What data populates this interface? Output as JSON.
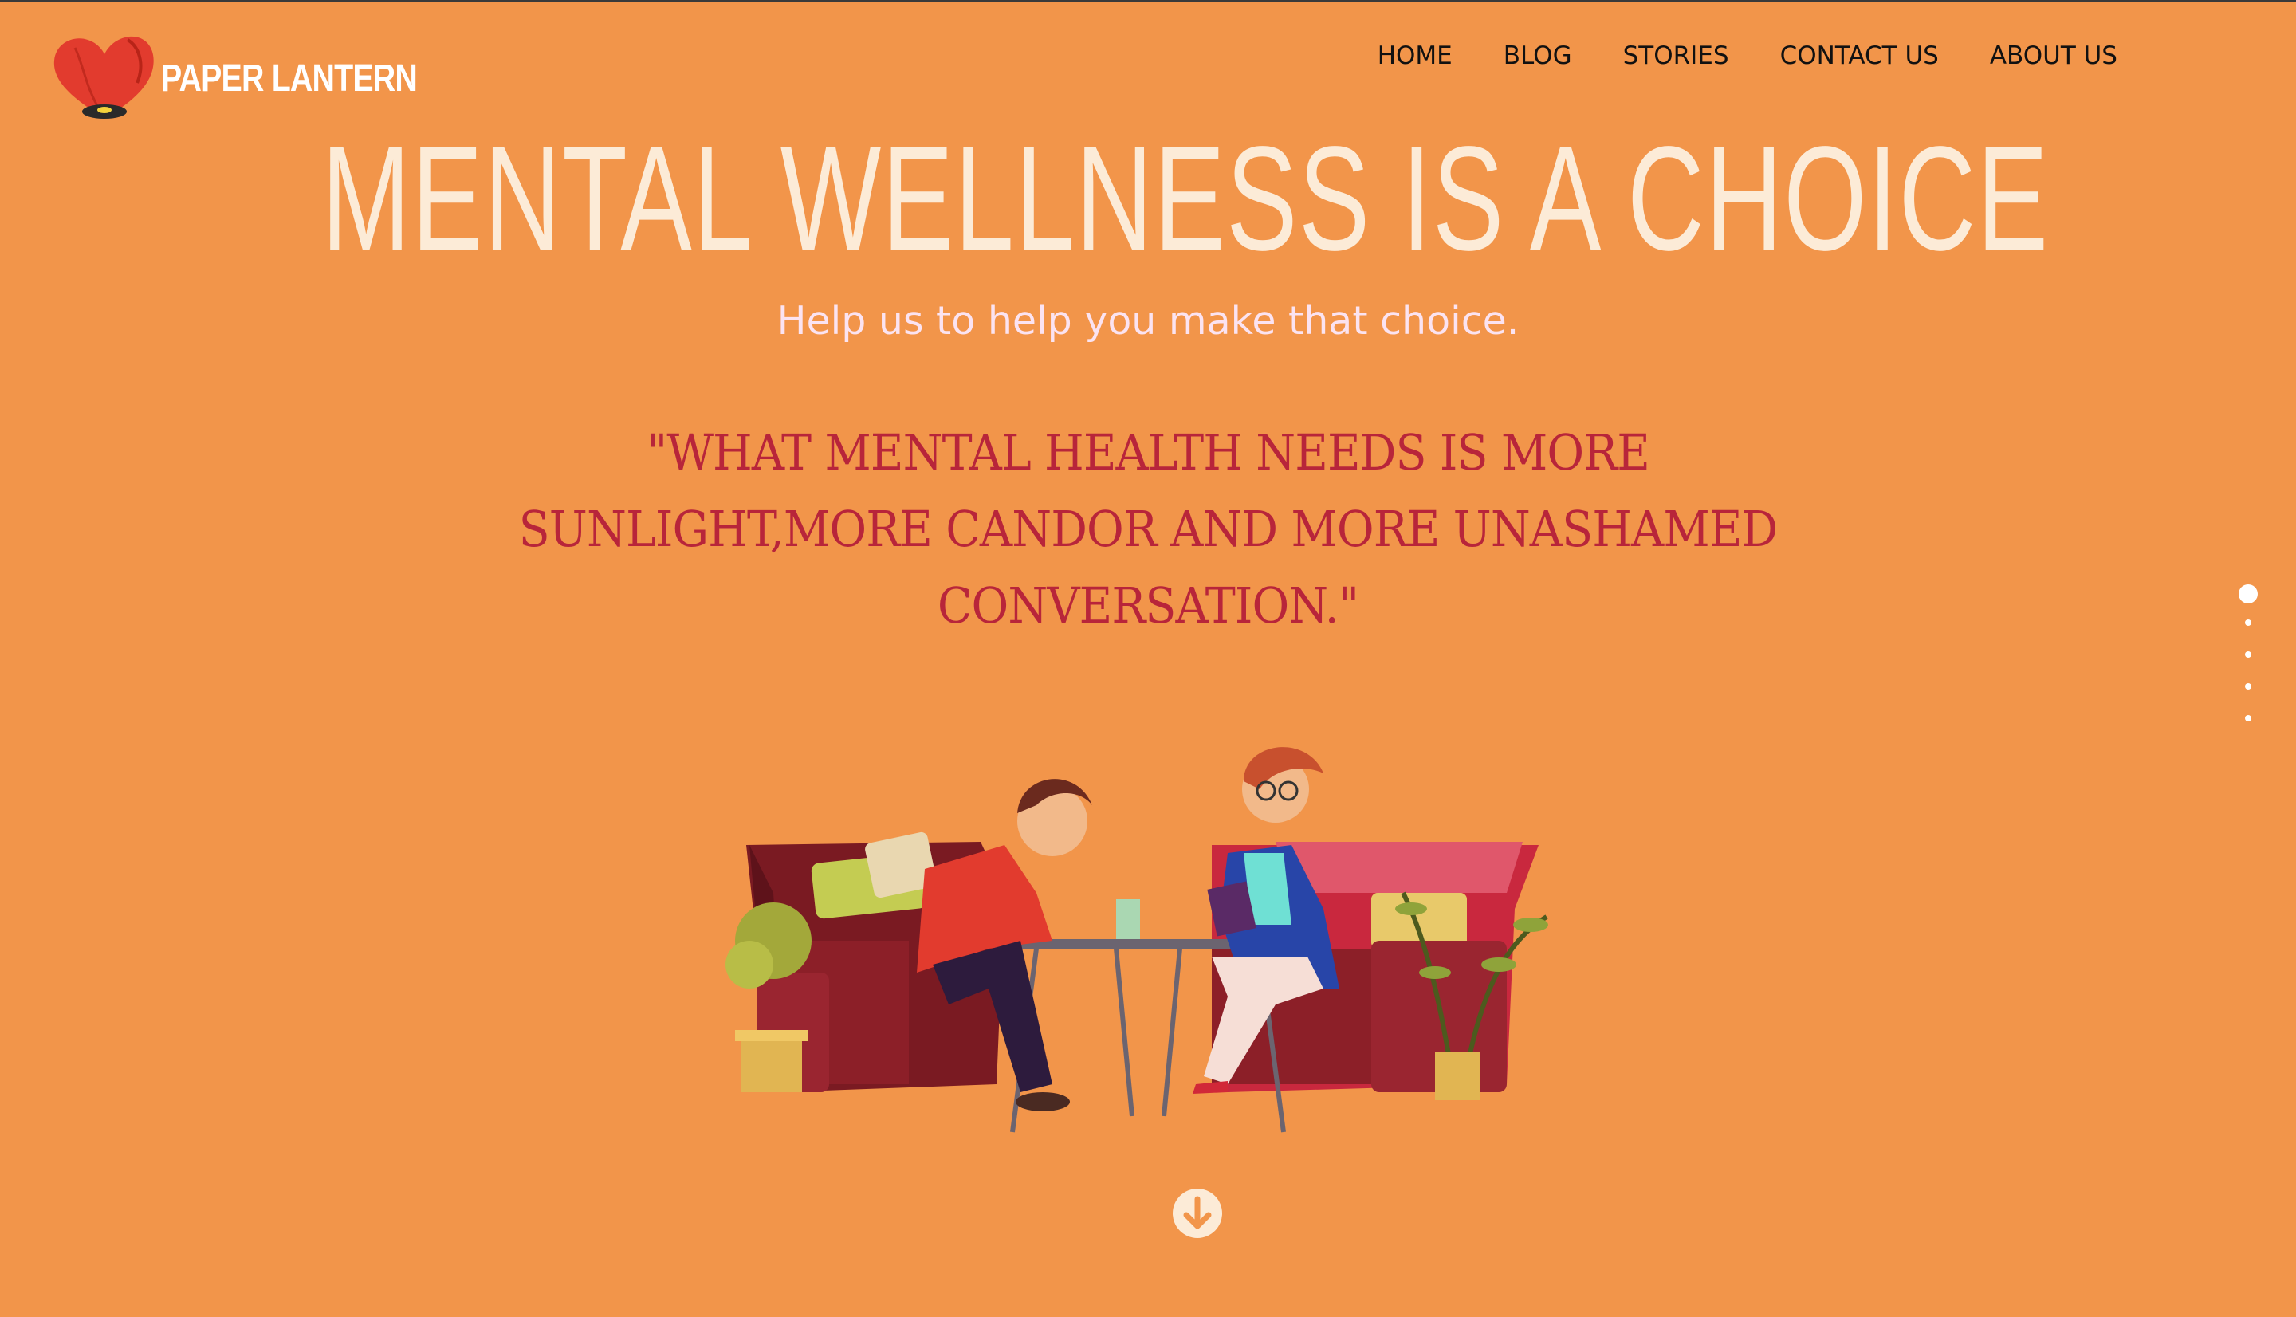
{
  "brand": {
    "name": "PAPER LANTERN",
    "logo_icon": "heart-lantern-icon",
    "colors": {
      "background": "#f2954a",
      "logo_red": "#e23b2e",
      "title": "#fcebd7",
      "quote": "#b8253a"
    }
  },
  "nav": {
    "items": [
      {
        "label": "HOME"
      },
      {
        "label": "BLOG"
      },
      {
        "label": "STORIES"
      },
      {
        "label": "CONTACT US"
      },
      {
        "label": "ABOUT US"
      }
    ]
  },
  "hero": {
    "title": "MENTAL WELLNESS IS A CHOICE",
    "subtitle": "Help us to help you make that choice.",
    "quote_lines": [
      "\"WHAT MENTAL HEALTH NEEDS IS MORE",
      "SUNLIGHT,MORE CANDOR AND MORE UNASHAMED",
      "CONVERSATION.\""
    ],
    "illustration_icon": "therapy-session-illustration",
    "scroll_icon": "arrow-down-circle-icon"
  },
  "pagination": {
    "total": 5,
    "active_index": 0
  }
}
